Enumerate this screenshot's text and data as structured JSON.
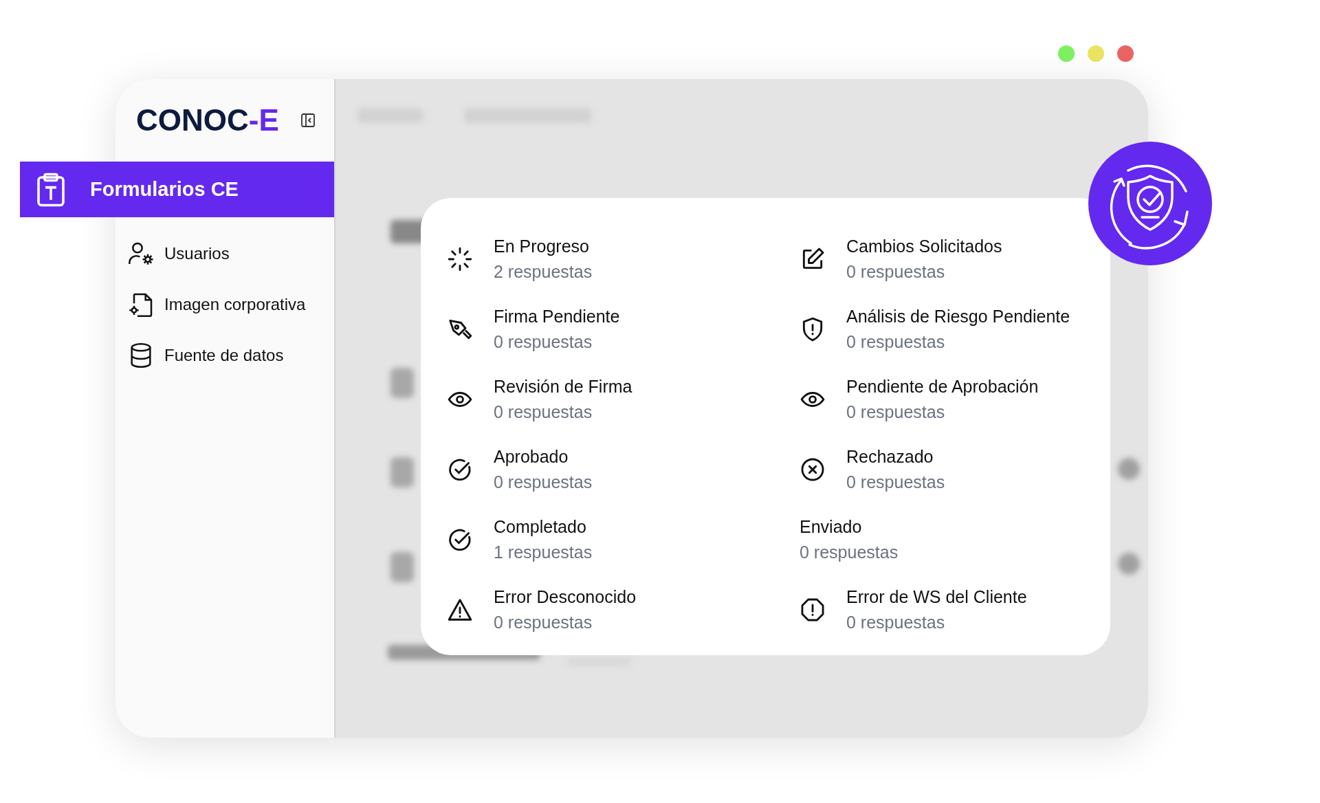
{
  "window_controls": [
    {
      "color": "#7ef163"
    },
    {
      "color": "#ebe463"
    },
    {
      "color": "#ea6464"
    }
  ],
  "sidebar": {
    "logo": {
      "main": "CONOC",
      "accent": "-E"
    },
    "items": [
      {
        "label": "Formularios CE",
        "kind": "clipboard",
        "selected": true
      },
      {
        "label": "Usuarios",
        "kind": "user-gear",
        "selected": false
      },
      {
        "label": "Imagen corporativa",
        "kind": "file-gear",
        "selected": false
      },
      {
        "label": "Fuente de datos",
        "kind": "database",
        "selected": false
      }
    ]
  },
  "status_summary": [
    {
      "title": "En Progreso",
      "count": "2 respuestas",
      "kind": "spinner"
    },
    {
      "title": "Cambios Solicitados",
      "count": "0 respuestas",
      "kind": "edit"
    },
    {
      "title": "Firma Pendiente",
      "count": "0 respuestas",
      "kind": "pen"
    },
    {
      "title": "Análisis de Riesgo Pendiente",
      "count": "0 respuestas",
      "kind": "shield-alert"
    },
    {
      "title": "Revisión de Firma",
      "count": "0 respuestas",
      "kind": "eye"
    },
    {
      "title": "Pendiente de Aprobación",
      "count": "0 respuestas",
      "kind": "eye"
    },
    {
      "title": "Aprobado",
      "count": "0 respuestas",
      "kind": "check"
    },
    {
      "title": "Rechazado",
      "count": "0 respuestas",
      "kind": "x"
    },
    {
      "title": "Completado",
      "count": "1 respuestas",
      "kind": "check"
    },
    {
      "title": "Enviado",
      "count": "0 respuestas",
      "kind": "plain"
    },
    {
      "title": "Error Desconocido",
      "count": "0 respuestas",
      "kind": "warning"
    },
    {
      "title": "Error de WS del Cliente",
      "count": "0 respuestas",
      "kind": "octagon"
    }
  ]
}
